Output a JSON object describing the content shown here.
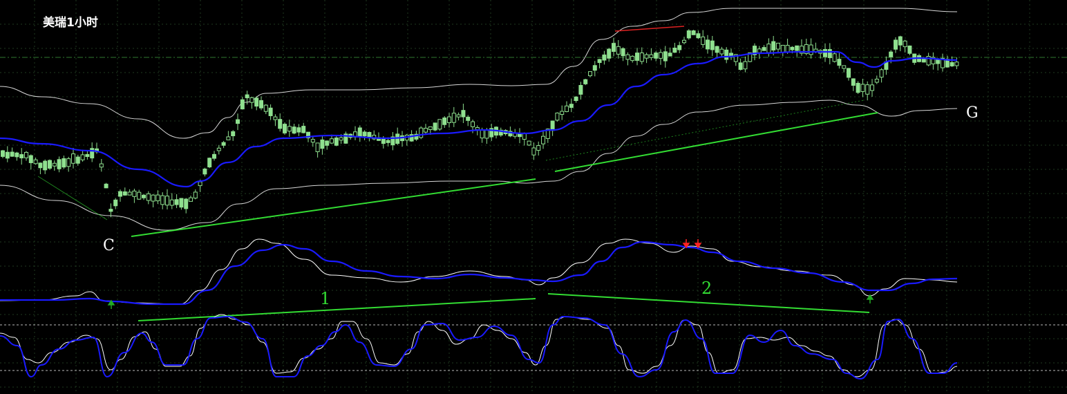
{
  "chart_data": {
    "type": "candlestick",
    "title": "美瑞1小时",
    "annotations": {
      "point_c": "C",
      "point_g": "G",
      "divergence_1": "1",
      "divergence_2": "2"
    },
    "colors": {
      "background": "#000000",
      "grid": "#1f3a1f",
      "candle": "#8fe08f",
      "bollinger_band": "#d8d8d8",
      "moving_average": "#1a1aff",
      "trendline": "#33dd33",
      "resistance_line": "#dd2222",
      "level_line": "#2f7a2f",
      "signal_down_arrow": "#ff2222",
      "signal_up_arrow": "#22aa22",
      "oscillator_fast": "#ffffff",
      "oscillator_slow": "#1a1aff",
      "oscillator_levels": "#bbbbbb"
    },
    "signals": {
      "down_arrows": 2,
      "up_arrows": 2
    }
  }
}
